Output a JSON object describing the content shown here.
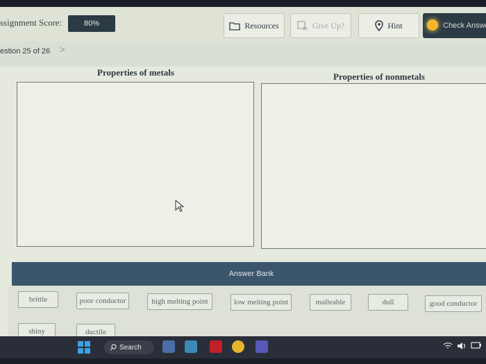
{
  "topbar": {
    "score_label": "ssignment Score:",
    "score_value": "80%",
    "resources_label": "Resources",
    "giveup_label": "Give Up?",
    "hint_label": "Hint",
    "check_label": "Check Answe"
  },
  "nav": {
    "question_label": "estion 25 of 26",
    "next_glyph": ">"
  },
  "columns": {
    "metals_title": "Properties of metals",
    "nonmetals_title": "Properties of nonmetals"
  },
  "answer_bank": {
    "header": "Answer Bank",
    "items": [
      "brittle",
      "poor conductor",
      "high melting point",
      "low melting point",
      "malleable",
      "dull",
      "good conductor",
      "shiny",
      "ductile"
    ]
  },
  "taskbar": {
    "search_label": "Search"
  },
  "icons": [
    "folder-icon",
    "give-up-icon",
    "location-pin-icon",
    "cursor-icon",
    "windows-start-icon",
    "search-icon",
    "wifi-icon",
    "speaker-icon",
    "battery-icon"
  ]
}
